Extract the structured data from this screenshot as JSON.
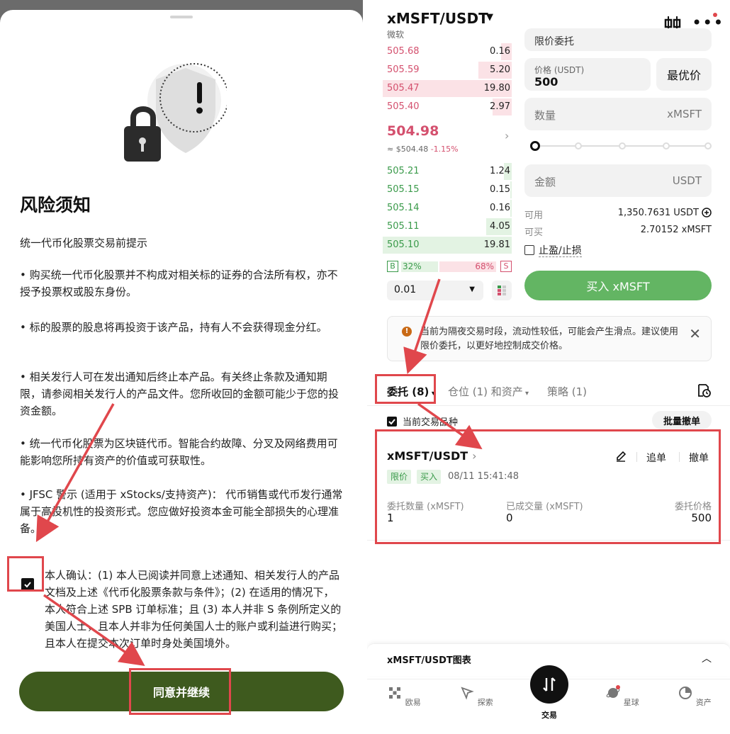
{
  "left": {
    "title": "风险须知",
    "subtitle": "统一代币化股票交易前提示",
    "paragraphs": [
      "• 购买统一代币化股票并不构成对相关标的证券的合法所有权，亦不授予投票权或股东身份。",
      "• 标的股票的股息将再投资于该产品，持有人不会获得现金分红。",
      "• 相关发行人可在发出通知后终止本产品。有关终止条款及通知期限，请参阅相关发行人的产品文件。您所收回的金额可能少于您的投资金额。",
      "• 统一代币化股票为区块链代币。智能合约故障、分叉及网络费用可能影响您所持有资产的价值或可获取性。",
      "• JFSC 警示 (适用于 xStocks/支持资产)： 代币销售或代币发行通常属于高投机性的投资形式。您应做好投资本金可能全部损失的心理准备。"
    ],
    "confirm_text": "本人确认：(1) 本人已阅读并同意上述通知、相关发行人的产品文档及上述《代币化股票条款与条件》；(2) 在适用的情况下，本人符合上述 SPB 订单标准；且 (3) 本人并非 S 条例所定义的美国人士，且本人并非为任何美国人士的账户或利益进行购买；且本人在提交本次订单时身处美国境外。",
    "confirm_checked": true,
    "agree_button": "同意并继续"
  },
  "right": {
    "symbol": "xMSFT/USDT",
    "name": "微软",
    "order_type_partial": "限价委托",
    "asks": [
      {
        "price": "505.68",
        "qty": "0.16",
        "depth": 0.08
      },
      {
        "price": "505.59",
        "qty": "5.20",
        "depth": 0.26
      },
      {
        "price": "505.47",
        "qty": "19.80",
        "depth": 1.0
      },
      {
        "price": "505.40",
        "qty": "2.97",
        "depth": 0.15
      }
    ],
    "last_price": "504.98",
    "last_usd": "≈ $504.48",
    "last_change": "-1.15%",
    "bids": [
      {
        "price": "505.21",
        "qty": "1.24",
        "depth": 0.06
      },
      {
        "price": "505.15",
        "qty": "0.15",
        "depth": 0.01
      },
      {
        "price": "505.14",
        "qty": "0.16",
        "depth": 0.01
      },
      {
        "price": "505.11",
        "qty": "4.05",
        "depth": 0.2
      },
      {
        "price": "505.10",
        "qty": "19.81",
        "depth": 1.0
      }
    ],
    "buy_label": "B",
    "sell_label": "S",
    "buy_ratio": "32%",
    "sell_ratio": "68%",
    "step": "0.01",
    "price_label": "价格 (USDT)",
    "price_value": "500",
    "best_price": "最优价",
    "qty_label": "数量",
    "qty_unit": "xMSFT",
    "amount_label": "金额",
    "amount_unit": "USDT",
    "available_label": "可用",
    "available_value": "1,350.7631 USDT",
    "buyable_label": "可买",
    "buyable_value": "2.70152 xMSFT",
    "tpsl_label": "止盈/止损",
    "buy_button": "买入 xMSFT",
    "notice": "当前为隔夜交易时段，流动性较低，可能会产生滑点。建议使用限价委托，以更好地控制成交价格。",
    "tabs": [
      "委托 (8)",
      "仓位 (1) 和资产",
      "策略 (1)"
    ],
    "current_pair_label": "当前交易品种",
    "bulk_cancel": "批量撤单",
    "order": {
      "symbol": "xMSFT/USDT",
      "edit_label": "追单",
      "cancel_label": "撤单",
      "tag_type": "限价",
      "tag_side": "买入",
      "time": "08/11 15:41:48",
      "cols": [
        {
          "h": "委托数量 (xMSFT)",
          "v": "1"
        },
        {
          "h": "已成交量 (xMSFT)",
          "v": "0"
        },
        {
          "h": "委托价格",
          "v": "500"
        }
      ]
    },
    "chart_title": "xMSFT/USDT图表",
    "nav": [
      "欧易",
      "探索",
      "交易",
      "星球",
      "资产"
    ]
  }
}
